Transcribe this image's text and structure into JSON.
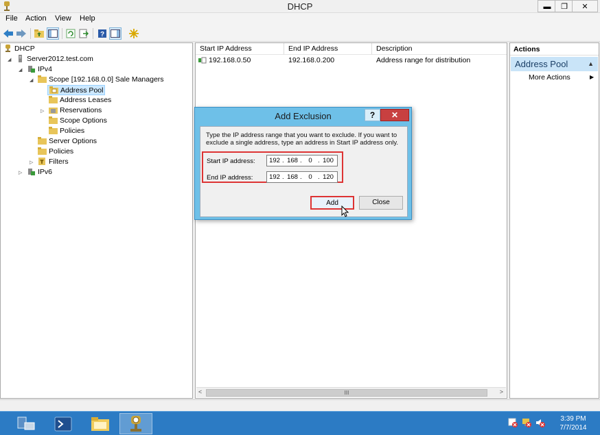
{
  "window": {
    "title": "DHCP",
    "minimize": "▬",
    "restore": "❐",
    "close": "✕"
  },
  "menu": [
    "File",
    "Action",
    "View",
    "Help"
  ],
  "tree": {
    "root": "DHCP",
    "server": "Server2012.test.com",
    "ipv4": "IPv4",
    "scope": "Scope [192.168.0.0] Sale Managers",
    "address_pool": "Address Pool",
    "address_leases": "Address Leases",
    "reservations": "Reservations",
    "scope_options": "Scope Options",
    "scope_policies": "Policies",
    "server_options": "Server Options",
    "policies": "Policies",
    "filters": "Filters",
    "ipv6": "IPv6"
  },
  "list": {
    "columns": [
      "Start IP Address",
      "End IP Address",
      "Description"
    ],
    "rows": [
      {
        "start": "192.168.0.50",
        "end": "192.168.0.200",
        "description": "Address range for distribution"
      }
    ],
    "scroll_grip": "III"
  },
  "actions": {
    "header": "Actions",
    "section": "Address Pool",
    "more": "More Actions",
    "more_arrow": "▶",
    "section_arrow": "▲"
  },
  "dialog": {
    "title": "Add Exclusion",
    "help": "?",
    "close": "✕",
    "description": "Type the IP address range that you want to exclude. If you want to exclude a single address, type an address in Start IP address only.",
    "start_label": "Start IP address:",
    "end_label": "End IP address:",
    "start_ip": [
      "192",
      "168",
      "0",
      "100"
    ],
    "end_ip": [
      "192",
      "168",
      "0",
      "120"
    ],
    "add": "Add",
    "close_btn": "Close"
  },
  "clock": {
    "time": "3:39 PM",
    "date": "7/7/2014"
  },
  "colors": {
    "taskbar": "#2c7bc4",
    "dialog_frame": "#6ec0e8",
    "highlight": "#d33333",
    "selection": "#cce8ff"
  }
}
